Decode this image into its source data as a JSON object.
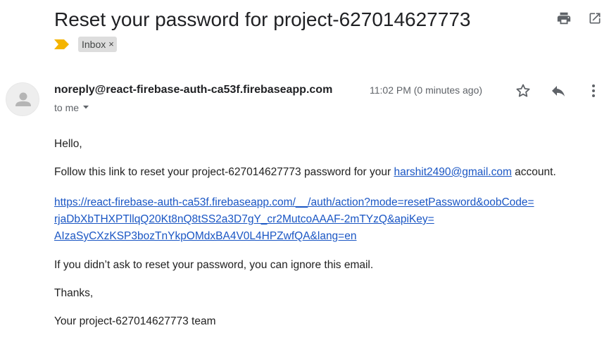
{
  "email": {
    "subject": "Reset your password for project-627014627773",
    "label": "Inbox",
    "label_remove": "×",
    "sender": "noreply@react-firebase-auth-ca53f.firebaseapp.com",
    "timestamp": "11:02 PM (0 minutes ago)",
    "recipient": "to me",
    "body": {
      "greeting": "Hello,",
      "follow_prefix": "Follow this link to reset your project-627014627773 password for your ",
      "email_link": "harshit2490@gmail.com",
      "follow_suffix": " account.",
      "reset_link_lines": [
        "https://react-firebase-auth-ca53f.firebaseapp.com/__/auth/action?mode=resetPassword&oobCode=",
        "rjaDbXbTHXPTllqQ20Kt8nQ8tSS2a3D7gY_cr2MutcoAAAF-2mTYzQ&apiKey=",
        "AIzaSyCXzKSP3bozTnYkpOMdxBA4V0L4HPZwfQA&lang=en"
      ],
      "ignore": "If you didn’t ask to reset your password, you can ignore this email.",
      "thanks": "Thanks,",
      "signoff": "Your project-627014627773 team"
    }
  },
  "icons": {
    "print": "printer-icon",
    "open_new_window": "open-in-new-window-icon",
    "importance": "importance-marker-icon",
    "avatar": "default-avatar-icon",
    "star": "star-icon",
    "reply": "reply-icon",
    "more": "more-vertical-icon",
    "recipient_dropdown": "caret-down-icon"
  },
  "colors": {
    "importance_marker": "#f4b400",
    "link": "#1a56c4",
    "label_chip_bg": "#dddddd",
    "secondary_text": "#5f6368"
  }
}
